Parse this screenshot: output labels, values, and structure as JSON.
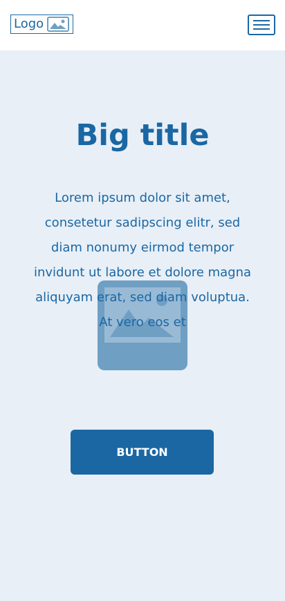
{
  "header": {
    "logo_text": "Logo",
    "logo_icon": "image-icon",
    "menu_icon": "hamburger-menu-icon"
  },
  "main": {
    "title": "Big title",
    "paragraph": "Lorem ipsum dolor sit amet, consetetur sadipscing elitr, sed diam nonumy eirmod tempor invidunt ut labore et dolore magna aliquyam erat, sed diam voluptua. At vero eos et",
    "image_icon": "image-placeholder-icon",
    "button_label": "BUTTON"
  },
  "colors": {
    "accent": "#1a67a3",
    "background": "#e8eff7",
    "header_bg": "#ffffff",
    "image_placeholder": "#6f9fc3"
  }
}
